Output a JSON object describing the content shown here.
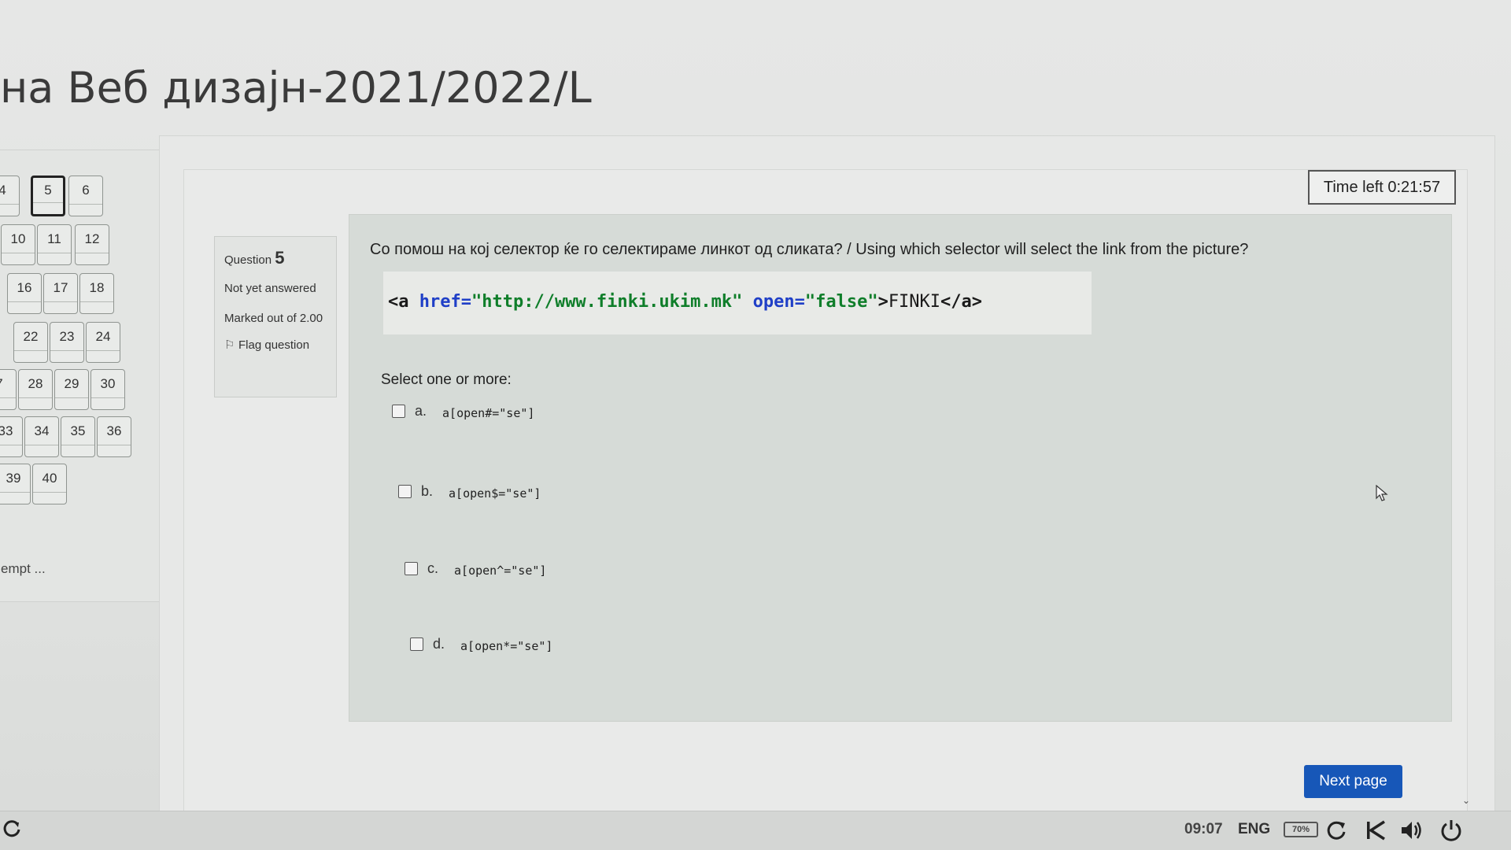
{
  "course_title": "на Веб дизајн-2021/2022/L",
  "quiz_nav": {
    "heading": "ı",
    "buttons": [
      "4",
      "5",
      "6",
      "10",
      "11",
      "12",
      "16",
      "17",
      "18",
      "22",
      "23",
      "24",
      "7",
      "28",
      "29",
      "30",
      "33",
      "34",
      "35",
      "36",
      "39",
      "40"
    ],
    "current": "5",
    "finish_label": "empt ..."
  },
  "timer": {
    "text": "Time left 0:21:57"
  },
  "question_info": {
    "label": "Question",
    "number": "5",
    "state": "Not yet answered",
    "grade": "Marked out of 2.00",
    "flag_label": "Flag question"
  },
  "question": {
    "text": "Со помош на кој селектор ќе го селектираме линкот од сликата? / Using which selector will select the link from the picture?",
    "code": {
      "tag_open": "<a",
      "attr1": "href=",
      "val1": "\"http://www.finki.ukim.mk\"",
      "attr2": "open=",
      "val2": "\"false\"",
      "close": ">",
      "text": "FINKI",
      "tag_close": "</a>"
    },
    "prompt": "Select one or more:",
    "answers": [
      {
        "letter": "a.",
        "code": "a[open#=\"se\"]"
      },
      {
        "letter": "b.",
        "code": "a[open$=\"se\"]"
      },
      {
        "letter": "c.",
        "code": "a[open^=\"se\"]"
      },
      {
        "letter": "d.",
        "code": "a[open*=\"se\"]"
      }
    ]
  },
  "next_button": {
    "label": "Next page"
  },
  "taskbar": {
    "time": "09:07",
    "language": "ENG",
    "battery": "70%"
  }
}
